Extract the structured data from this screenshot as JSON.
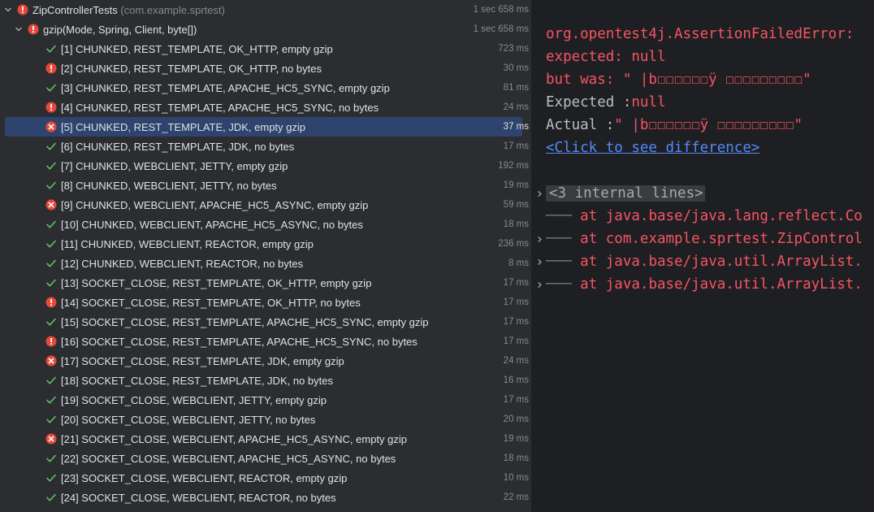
{
  "root": {
    "name": "ZipControllerTests",
    "package": "(com.example.sprtest)",
    "time": "1 sec 658 ms",
    "status": "fail"
  },
  "group": {
    "name": "gzip(Mode, Spring, Client, byte[])",
    "time": "1 sec 658 ms",
    "status": "fail"
  },
  "tests": [
    {
      "label": "[1] CHUNKED, REST_TEMPLATE, OK_HTTP, empty gzip",
      "time": "723 ms",
      "status": "pass"
    },
    {
      "label": "[2] CHUNKED, REST_TEMPLATE, OK_HTTP, no bytes",
      "time": "30 ms",
      "status": "fail"
    },
    {
      "label": "[3] CHUNKED, REST_TEMPLATE, APACHE_HC5_SYNC, empty gzip",
      "time": "81 ms",
      "status": "pass"
    },
    {
      "label": "[4] CHUNKED, REST_TEMPLATE, APACHE_HC5_SYNC, no bytes",
      "time": "24 ms",
      "status": "fail"
    },
    {
      "label": "[5] CHUNKED, REST_TEMPLATE, JDK, empty gzip",
      "time": "37 ms",
      "status": "error",
      "selected": true
    },
    {
      "label": "[6] CHUNKED, REST_TEMPLATE, JDK, no bytes",
      "time": "17 ms",
      "status": "pass"
    },
    {
      "label": "[7] CHUNKED, WEBCLIENT, JETTY, empty gzip",
      "time": "192 ms",
      "status": "pass"
    },
    {
      "label": "[8] CHUNKED, WEBCLIENT, JETTY, no bytes",
      "time": "19 ms",
      "status": "pass"
    },
    {
      "label": "[9] CHUNKED, WEBCLIENT, APACHE_HC5_ASYNC, empty gzip",
      "time": "59 ms",
      "status": "error"
    },
    {
      "label": "[10] CHUNKED, WEBCLIENT, APACHE_HC5_ASYNC, no bytes",
      "time": "18 ms",
      "status": "pass"
    },
    {
      "label": "[11] CHUNKED, WEBCLIENT, REACTOR, empty gzip",
      "time": "236 ms",
      "status": "pass"
    },
    {
      "label": "[12] CHUNKED, WEBCLIENT, REACTOR, no bytes",
      "time": "8 ms",
      "status": "pass"
    },
    {
      "label": "[13] SOCKET_CLOSE, REST_TEMPLATE, OK_HTTP, empty gzip",
      "time": "17 ms",
      "status": "pass"
    },
    {
      "label": "[14] SOCKET_CLOSE, REST_TEMPLATE, OK_HTTP, no bytes",
      "time": "17 ms",
      "status": "fail"
    },
    {
      "label": "[15] SOCKET_CLOSE, REST_TEMPLATE, APACHE_HC5_SYNC, empty gzip",
      "time": "17 ms",
      "status": "pass"
    },
    {
      "label": "[16] SOCKET_CLOSE, REST_TEMPLATE, APACHE_HC5_SYNC, no bytes",
      "time": "17 ms",
      "status": "fail"
    },
    {
      "label": "[17] SOCKET_CLOSE, REST_TEMPLATE, JDK, empty gzip",
      "time": "24 ms",
      "status": "error"
    },
    {
      "label": "[18] SOCKET_CLOSE, REST_TEMPLATE, JDK, no bytes",
      "time": "16 ms",
      "status": "pass"
    },
    {
      "label": "[19] SOCKET_CLOSE, WEBCLIENT, JETTY, empty gzip",
      "time": "17 ms",
      "status": "pass"
    },
    {
      "label": "[20] SOCKET_CLOSE, WEBCLIENT, JETTY, no bytes",
      "time": "20 ms",
      "status": "pass"
    },
    {
      "label": "[21] SOCKET_CLOSE, WEBCLIENT, APACHE_HC5_ASYNC, empty gzip",
      "time": "19 ms",
      "status": "error"
    },
    {
      "label": "[22] SOCKET_CLOSE, WEBCLIENT, APACHE_HC5_ASYNC, no bytes",
      "time": "18 ms",
      "status": "pass"
    },
    {
      "label": "[23] SOCKET_CLOSE, WEBCLIENT, REACTOR, empty gzip",
      "time": "10 ms",
      "status": "pass"
    },
    {
      "label": "[24] SOCKET_CLOSE, WEBCLIENT, REACTOR, no bytes",
      "time": "22 ms",
      "status": "pass"
    }
  ],
  "console": {
    "exception": "org.opentest4j.AssertionFailedError:",
    "expected_line": "expected: null",
    "but_was_line": " but was: \"  |b☐☐☐☐☐☐ÿ ☐☐☐☐☐☐☐☐☐\"",
    "expected_label": "Expected :",
    "expected_value": "null",
    "actual_label": "Actual   :",
    "actual_value": "\"  |b☐☐☐☐☐☐ÿ ☐☐☐☐☐☐☐☐☐\"",
    "diff_link": "<Click to see difference>",
    "internal_lines": "<3 internal lines>",
    "stack": [
      {
        "text": "at java.base/java.lang.reflect.Co",
        "foldable": false
      },
      {
        "text": "at com.example.sprtest.ZipControl",
        "foldable": true
      },
      {
        "text": "at java.base/java.util.ArrayList.",
        "foldable": true
      },
      {
        "text": "at java.base/java.util.ArrayList.",
        "foldable": true
      }
    ]
  },
  "colors": {
    "pass": "#5fb865",
    "fail": "#e5493a",
    "error": "#e5493a"
  }
}
